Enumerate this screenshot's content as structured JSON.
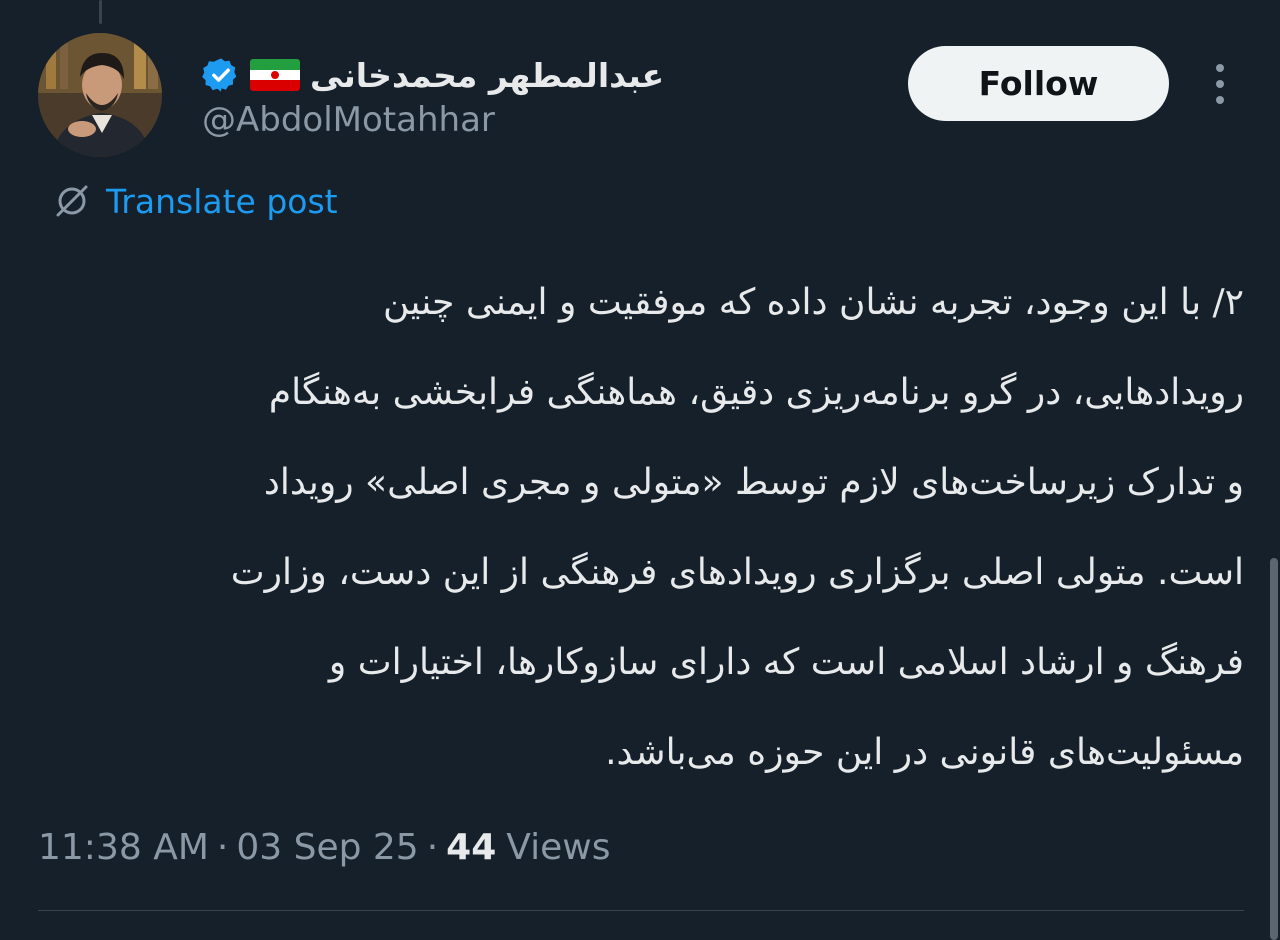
{
  "author": {
    "display_name": "عبدالمطهر محمدخانی",
    "handle": "@AbdolMotahhar",
    "avatar_icon": "profile-photo",
    "verified_icon": "verified-badge-icon",
    "flag_icon": "iran-flag-icon"
  },
  "actions": {
    "follow_label": "Follow",
    "more_icon": "more-vertical-icon"
  },
  "translate": {
    "label": "Translate post",
    "icon": "translate-globe-icon"
  },
  "post": {
    "lines": [
      "۲/ با این وجود، تجربه نشان داده که موفقیت و ایمنی چنین",
      "رویدادهایی، در گرو برنامه‌ریزی دقیق، هماهنگی فرابخشی به‌هنگام",
      "و تدارک زیرساخت‌های لازم توسط «متولی و مجری اصلی» رویداد",
      "است. متولی اصلی برگزاری رویدادهای فرهنگی از این دست، وزارت",
      "فرهنگ و ارشاد اسلامی است که دارای سازوکارها، اختیارات و",
      "مسئولیت‌های قانونی در این حوزه می‌باشد."
    ]
  },
  "meta": {
    "time": "11:38 AM",
    "separator": "·",
    "date": "03 Sep 25",
    "views_count": "44",
    "views_label": "Views"
  },
  "colors": {
    "background": "#15202b",
    "text": "#e7e9ea",
    "secondary": "#8b98a5",
    "link": "#1d9bf0",
    "verified": "#1d9bf0",
    "divider": "#38444d"
  }
}
